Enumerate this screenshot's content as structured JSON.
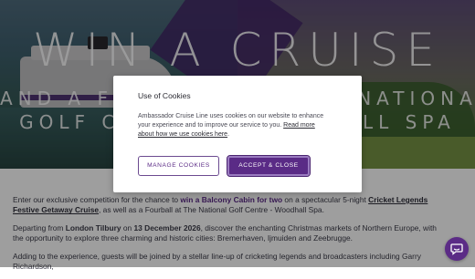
{
  "hero": {
    "title": "WIN A CRUISE",
    "subtitle_line1": "AND A FOURBALL AT THE NATIONAL",
    "subtitle_line2": "GOLF CENTRE - WOODHALL SPA"
  },
  "intro": {
    "pre": "Enter our exclusive competition for the chance to ",
    "prize": "win a Balcony Cabin for two",
    "mid": " on a spectacular 5-night ",
    "cruise_link": "Cricket Legends Festive Getaway Cruise",
    "post": ", as well as a Fourball at The National Golf Centre - Woodhall Spa."
  },
  "departure": {
    "pre": "Departing from ",
    "port": "London Tilbury",
    "on": " on ",
    "date": "13 December 2026",
    "post": ", discover the enchanting Christmas markets of Northern Europe, with the opportunity to explore three charming and historic cities: Bremerhaven, Ijmuiden and Zeebrugge."
  },
  "guests": {
    "text": "Adding to the experience, guests will be joined by a stellar line-up of cricketing legends and broadcasters including Garry Richardson,"
  },
  "cookie_modal": {
    "title": "Use of Cookies",
    "body": "Ambassador Cruise Line uses cookies on our website to enhance your experience and to improve our service to you. ",
    "link": "Read more about how we use cookies here",
    "link_suffix": ".",
    "manage_label": "MANAGE COOKIES",
    "accept_label": "ACCEPT & CLOSE"
  },
  "chat": {
    "icon": "chat-icon"
  },
  "colors": {
    "brand_purple": "#5b2b86"
  }
}
